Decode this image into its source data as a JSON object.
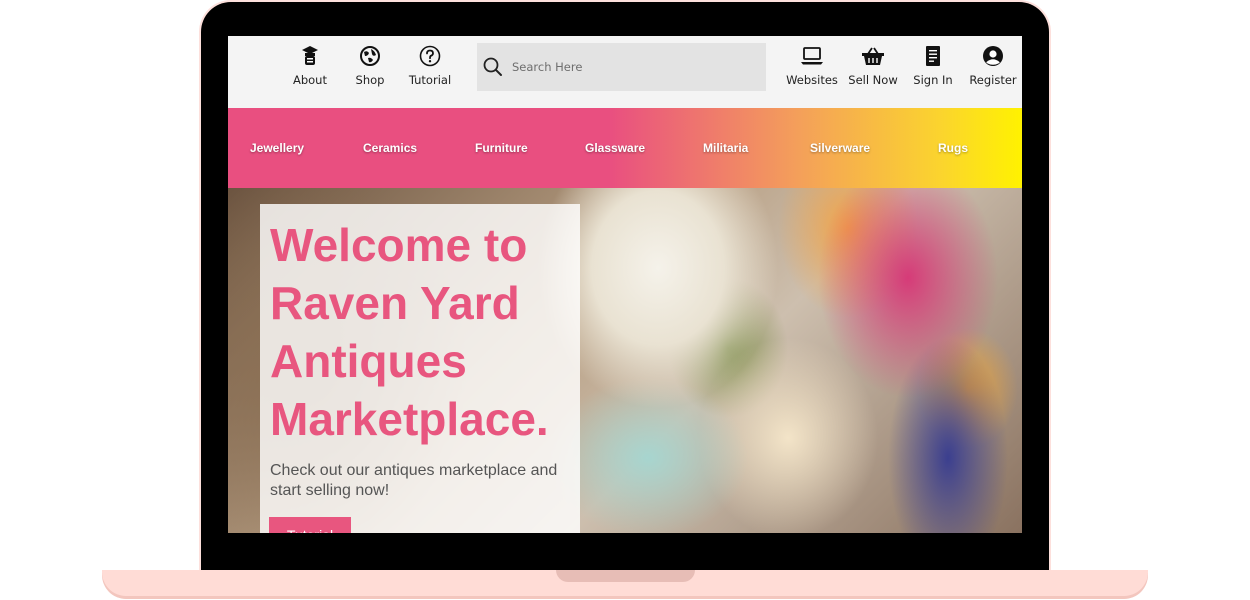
{
  "topnav": {
    "left_items": [
      {
        "label": "About",
        "icon": "graduation-cap-icon"
      },
      {
        "label": "Shop",
        "icon": "globe-icon"
      },
      {
        "label": "Tutorial",
        "icon": "question-circle-icon"
      }
    ],
    "search": {
      "placeholder": "Search Here",
      "icon": "search-icon"
    },
    "right_items": [
      {
        "label": "Websites",
        "icon": "laptop-icon"
      },
      {
        "label": "Sell Now",
        "icon": "basket-icon"
      },
      {
        "label": "Sign In",
        "icon": "document-icon"
      },
      {
        "label": "Register",
        "icon": "user-circle-icon"
      }
    ]
  },
  "categories": [
    "Jewellery",
    "Ceramics",
    "Furniture",
    "Glassware",
    "Militaria",
    "Silverware",
    "Rugs"
  ],
  "hero": {
    "title_lines": [
      "Welcome to",
      "Raven Yard",
      "Antiques",
      "Marketplace."
    ],
    "subtitle": "Check out our antiques marketplace and start selling now!",
    "button_label": "Tutorial"
  },
  "colors": {
    "brand_pink": "#e8567f",
    "gradient_end_yellow": "#fff200",
    "nav_background": "#f4f4f4",
    "laptop_frame": "#ffdcd6"
  }
}
